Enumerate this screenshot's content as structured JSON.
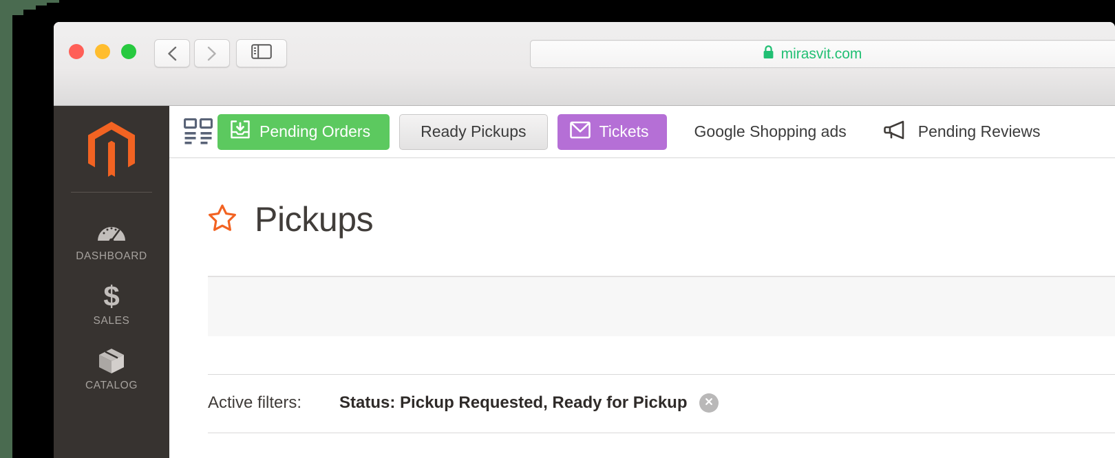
{
  "window": {
    "traffic_lights": [
      "close",
      "minimize",
      "maximize"
    ],
    "back_label": "Back",
    "forward_label": "Forward",
    "sidebar_toggle_label": "Show Sidebar",
    "url": "mirasvit.com",
    "secure": true
  },
  "sidebar": {
    "logo": "magento-logo",
    "items": [
      {
        "icon": "dashboard-gauge-icon",
        "label": "DASHBOARD"
      },
      {
        "icon": "dollar-sign-icon",
        "label": "SALES"
      },
      {
        "icon": "box-icon",
        "label": "CATALOG"
      }
    ]
  },
  "toolbar": {
    "grid_icon": "grid-list-icon",
    "buttons": [
      {
        "label": "Pending Orders",
        "icon": "inbox-download-icon",
        "style": "green"
      },
      {
        "label": "Ready Pickups",
        "icon": "none",
        "style": "grey"
      },
      {
        "label": "Tickets",
        "icon": "envelope-icon",
        "style": "purple"
      },
      {
        "label": "Google Shopping ads",
        "icon": "none",
        "style": "plain"
      },
      {
        "label": "Pending Reviews",
        "icon": "megaphone-icon",
        "style": "plain-icon"
      }
    ]
  },
  "content": {
    "title": "Pickups",
    "title_icon": "star-outline-icon",
    "filters": {
      "label": "Active filters:",
      "value": "Status: Pickup Requested, Ready for Pickup",
      "remove_icon": "close-circle-icon"
    }
  },
  "colors": {
    "accent_green": "#5cc95f",
    "accent_purple": "#b56fd6",
    "magento_orange": "#f26322",
    "sidebar_dark": "#373330",
    "url_green": "#21bf73",
    "desktop_green": "#4a6b50"
  }
}
